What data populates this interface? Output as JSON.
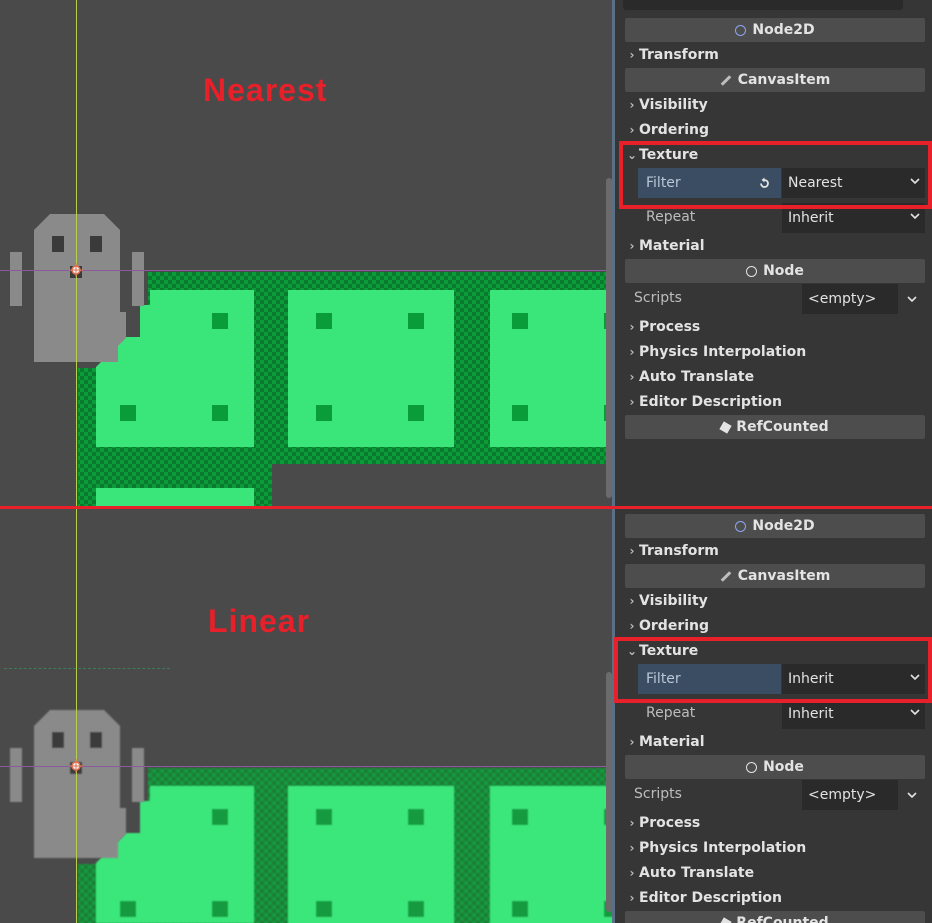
{
  "labels": {
    "top_mode": "Nearest",
    "bottom_mode": "Linear"
  },
  "inspector_top": {
    "node2d": "Node2D",
    "transform": "Transform",
    "canvas_item": "CanvasItem",
    "visibility": "Visibility",
    "ordering": "Ordering",
    "texture": "Texture",
    "filter_label": "Filter",
    "filter_value": "Nearest",
    "repeat_label": "Repeat",
    "repeat_value": "Inherit",
    "material": "Material",
    "node": "Node",
    "scripts_label": "Scripts",
    "scripts_value": "<empty>",
    "process": "Process",
    "physics_interpolation": "Physics Interpolation",
    "auto_translate": "Auto Translate",
    "editor_description": "Editor Description",
    "refcounted": "RefCounted"
  },
  "inspector_bottom": {
    "node2d": "Node2D",
    "transform": "Transform",
    "canvas_item": "CanvasItem",
    "visibility": "Visibility",
    "ordering": "Ordering",
    "texture": "Texture",
    "filter_label": "Filter",
    "filter_value": "Inherit",
    "repeat_label": "Repeat",
    "repeat_value": "Inherit",
    "material": "Material",
    "node": "Node",
    "scripts_label": "Scripts",
    "scripts_value": "<empty>",
    "process": "Process",
    "physics_interpolation": "Physics Interpolation",
    "auto_translate": "Auto Translate",
    "editor_description": "Editor Description",
    "refcounted": "RefCounted"
  },
  "colors": {
    "highlight": "#e8202a",
    "tile_light": "#3ae67a",
    "tile_dark": "#0a9c38",
    "ghost": "#8a8a8a",
    "filter_bg": "#3b4d62"
  }
}
